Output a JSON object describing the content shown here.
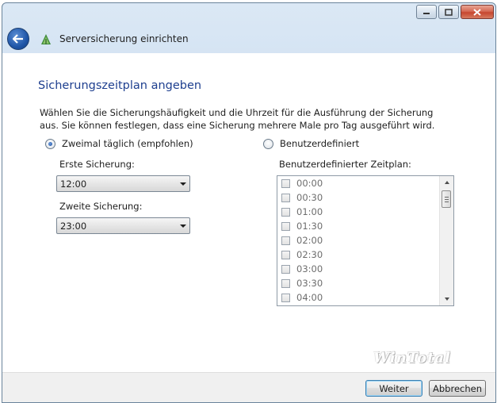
{
  "window": {
    "title": "Serversicherung einrichten",
    "caption": {
      "minimize_icon": "minimize-icon",
      "maximize_icon": "maximize-icon",
      "close_icon": "close-icon"
    }
  },
  "page": {
    "title": "Sicherungszeitplan angeben",
    "description": "Wählen Sie die Sicherungshäufigkeit und die Uhrzeit für die Ausführung der Sicherung aus. Sie können festlegen, dass eine Sicherung mehrere Male pro Tag ausgeführt wird."
  },
  "options": {
    "twice_daily": {
      "label": "Zweimal täglich (empfohlen)",
      "selected": true
    },
    "custom": {
      "label": "Benutzerdefiniert",
      "selected": false
    }
  },
  "first_backup": {
    "label": "Erste Sicherung:",
    "value": "12:00"
  },
  "second_backup": {
    "label": "Zweite Sicherung:",
    "value": "23:00"
  },
  "custom_schedule": {
    "label": "Benutzerdefinierter Zeitplan:",
    "times": [
      "00:00",
      "00:30",
      "01:00",
      "01:30",
      "02:00",
      "02:30",
      "03:00",
      "03:30",
      "04:00"
    ]
  },
  "buttons": {
    "next": "Weiter",
    "cancel": "Abbrechen"
  },
  "watermark": "WinTotal",
  "colors": {
    "title_blue": "#1e3f8f",
    "header_gradient": "#c9dcef",
    "disabled_text": "#6d6d6d"
  }
}
